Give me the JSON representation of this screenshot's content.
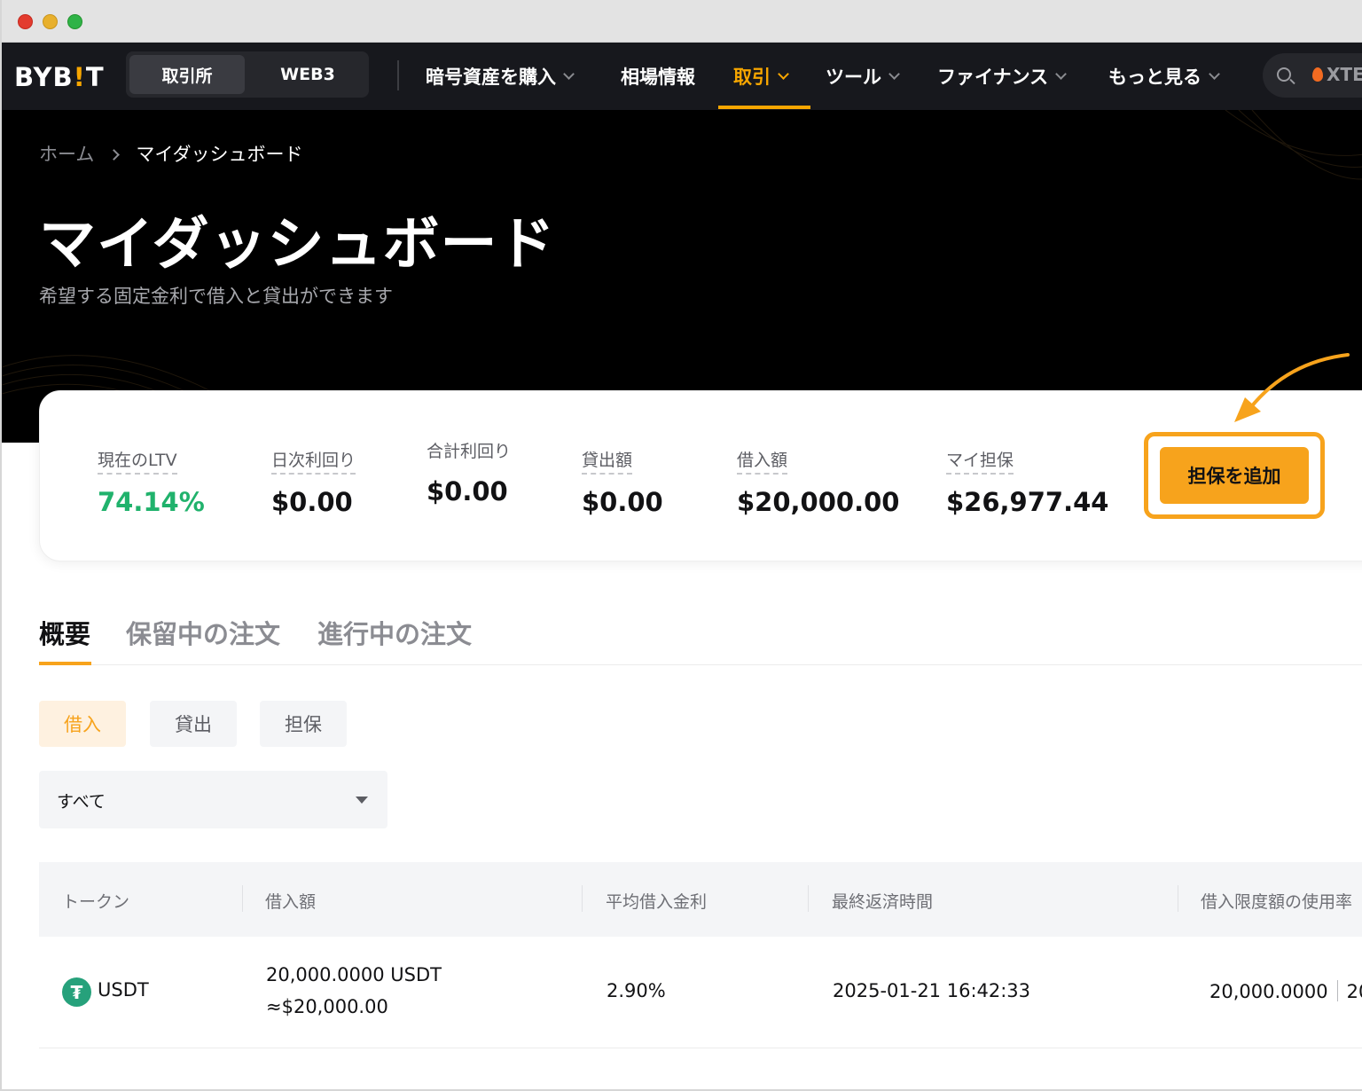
{
  "nav": {
    "logo_main": "BYB",
    "logo_bang": "!",
    "logo_end": "T",
    "segments": [
      "取引所",
      "WEB3"
    ],
    "items": [
      {
        "label": "暗号資産を購入"
      },
      {
        "label": "相場情報"
      },
      {
        "label": "取引"
      },
      {
        "label": "ツール"
      },
      {
        "label": "ファイナンス"
      },
      {
        "label": "もっと見る"
      }
    ],
    "active_item": "取引",
    "search_hot": "XTE"
  },
  "breadcrumb": {
    "home": "ホーム",
    "current": "マイダッシュボード"
  },
  "header": {
    "title": "マイダッシュボード",
    "subtitle": "希望する固定金利で借入と貸出ができます"
  },
  "stats": [
    {
      "label": "現在のLTV",
      "value": "74.14%"
    },
    {
      "label": "日次利回り",
      "value": "$0.00"
    },
    {
      "label": "合計利回り",
      "value": "$0.00"
    },
    {
      "label": "貸出額",
      "value": "$0.00"
    },
    {
      "label": "借入額",
      "value": "$20,000.00"
    },
    {
      "label": "マイ担保",
      "value": "$26,977.44"
    }
  ],
  "add_collateral_label": "担保を追加",
  "tabs": [
    "概要",
    "保留中の注文",
    "進行中の注文"
  ],
  "pills": [
    "借入",
    "貸出",
    "担保"
  ],
  "filter": {
    "selected": "すべて"
  },
  "table": {
    "headers": [
      "トークン",
      "借入額",
      "平均借入金利",
      "最終返済時間",
      "借入限度額の使用率"
    ],
    "rows": [
      {
        "token_symbol": "₮",
        "token": "USDT",
        "amount": "20,000.0000 USDT",
        "amount_usd": "≈$20,000.00",
        "rate": "2.90%",
        "repay_time": "2025-01-21 16:42:33",
        "usage": "20,000.0000",
        "usage_cut": "20"
      }
    ]
  },
  "colors": {
    "accent": "#f7a31c",
    "positive": "#20b26c",
    "nav_bg": "#17181d",
    "usdt": "#26a17b"
  }
}
